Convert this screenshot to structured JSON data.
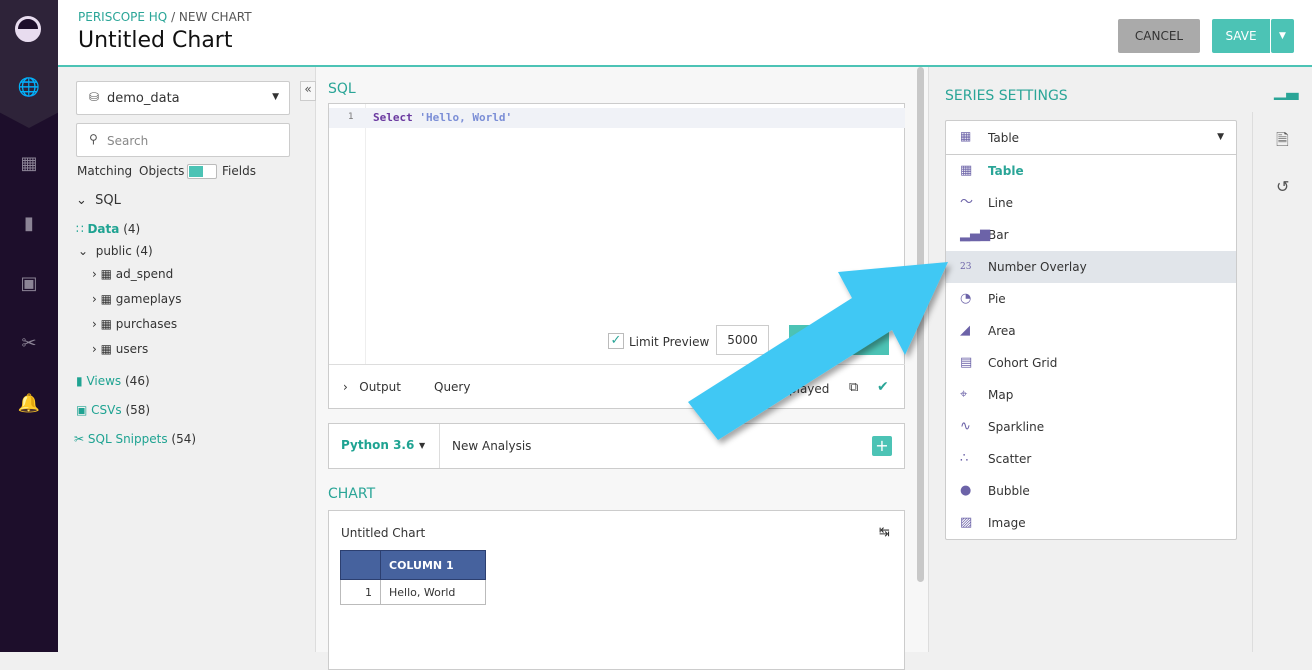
{
  "header": {
    "breadcrumb_root": "PERISCOPE HQ",
    "breadcrumb_sep": " / ",
    "breadcrumb_current": "NEW CHART",
    "title": "Untitled Chart",
    "cancel_label": "CANCEL",
    "save_label": "SAVE"
  },
  "nav": {
    "icons": [
      "logo-icon",
      "globe-icon",
      "dashboard-icon",
      "bookmark-icon",
      "csv-icon",
      "scissors-icon",
      "bell-icon"
    ]
  },
  "sidebar": {
    "database": "demo_data",
    "search_placeholder": "Search",
    "matching_label": "Matching",
    "objects_label": "Objects",
    "fields_label": "Fields",
    "sql_label": "SQL",
    "data_label": "Data",
    "data_count": "(4)",
    "schema_label": "public",
    "schema_count": "(4)",
    "tables": [
      "ad_spend",
      "gameplays",
      "purchases",
      "users"
    ],
    "views_label": "Views",
    "views_count": "(46)",
    "csvs_label": "CSVs",
    "csvs_count": "(58)",
    "snippets_label": "SQL Snippets",
    "snippets_count": "(54)"
  },
  "editor": {
    "section_label": "SQL",
    "line_number": "1",
    "keyword": "Select",
    "string": "'Hello, World'",
    "limit_label": "Limit Preview",
    "limit_value": "5000",
    "output_label": "Output",
    "query_label": "Query",
    "status_text": "played"
  },
  "python": {
    "version": "Python 3.6",
    "analysis": "New Analysis"
  },
  "chart": {
    "section_label": "CHART",
    "title": "Untitled Chart",
    "column_header": "COLUMN 1",
    "rows": [
      {
        "index": "1",
        "value": "Hello, World"
      }
    ]
  },
  "series": {
    "section_label": "SERIES SETTINGS",
    "selected": "Table",
    "highlighted": "Number Overlay",
    "options": [
      {
        "label": "Table",
        "icon": "table-icon"
      },
      {
        "label": "Line",
        "icon": "line-chart-icon"
      },
      {
        "label": "Bar",
        "icon": "bar-chart-icon"
      },
      {
        "label": "Number Overlay",
        "icon": "number-overlay-icon"
      },
      {
        "label": "Pie",
        "icon": "pie-chart-icon"
      },
      {
        "label": "Area",
        "icon": "area-chart-icon"
      },
      {
        "label": "Cohort Grid",
        "icon": "cohort-grid-icon"
      },
      {
        "label": "Map",
        "icon": "map-pin-icon"
      },
      {
        "label": "Sparkline",
        "icon": "sparkline-icon"
      },
      {
        "label": "Scatter",
        "icon": "scatter-icon"
      },
      {
        "label": "Bubble",
        "icon": "bubble-icon"
      },
      {
        "label": "Image",
        "icon": "image-icon"
      }
    ]
  },
  "colors": {
    "accent": "#2aa597",
    "nav": "#1d0e2b",
    "table_header": "#46629e",
    "arrow": "#40c8f4"
  }
}
